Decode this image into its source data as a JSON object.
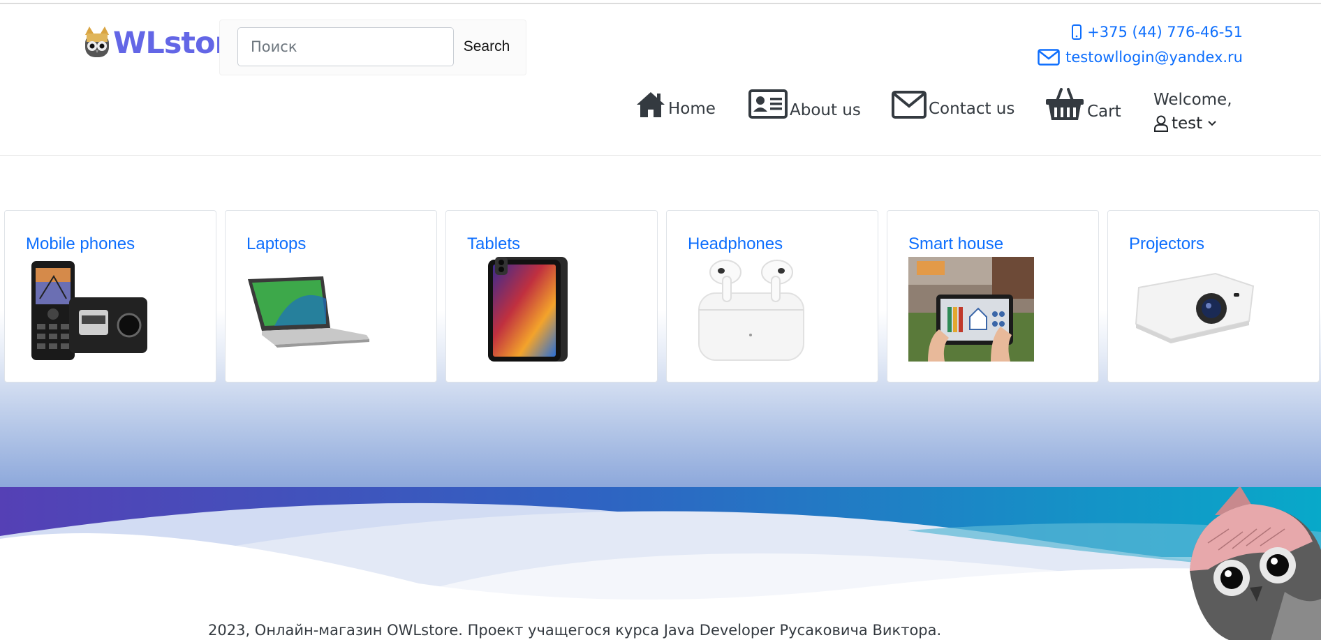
{
  "brand": {
    "name": "WLstore",
    "accent_color": "#6366e6"
  },
  "search": {
    "placeholder": "Поиск",
    "value": "",
    "button_label": "Search"
  },
  "contacts": {
    "phone": "+375 (44) 776-46-51",
    "phone_icon": "mobile-phone-icon",
    "email": "testowllogin@yandex.ru",
    "email_icon": "envelope-icon",
    "color": "#0d6efd"
  },
  "nav": {
    "items": [
      {
        "label": "Home",
        "icon": "house-icon"
      },
      {
        "label": "About us",
        "icon": "id-card-icon"
      },
      {
        "label": "Contact us",
        "icon": "envelope-icon"
      },
      {
        "label": "Cart",
        "icon": "shopping-basket-icon"
      }
    ],
    "welcome_text": "Welcome,",
    "username": "test",
    "user_icon": "user-icon",
    "dropdown_icon": "chevron-down-icon"
  },
  "categories": [
    {
      "title": "Mobile phones",
      "image": "mobile-phones-image"
    },
    {
      "title": "Laptops",
      "image": "laptop-image"
    },
    {
      "title": "Tablets",
      "image": "tablet-image"
    },
    {
      "title": "Headphones",
      "image": "earbuds-image"
    },
    {
      "title": "Smart house",
      "image": "smart-home-tablet-image"
    },
    {
      "title": "Projectors",
      "image": "projector-image"
    }
  ],
  "footer": {
    "text": "2023, Онлайн-магазин OWLstore. Проект учащегося курса Java Developer Русаковича Виктора.",
    "image": "owl-mascot-image"
  }
}
